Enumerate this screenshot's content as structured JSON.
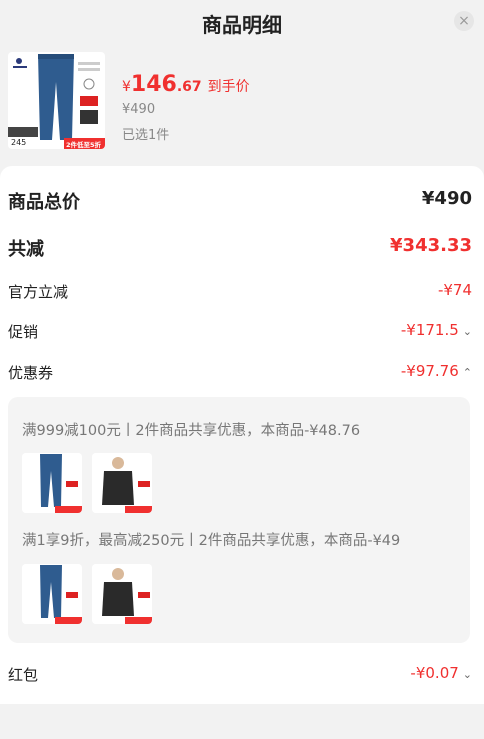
{
  "header": {
    "title": "商品明细",
    "close_glyph": "×"
  },
  "product": {
    "currency": "¥",
    "price_int": "146",
    "price_dec": ".67",
    "price_tag": "到手价",
    "original_price": "¥490",
    "selected": "已选1件",
    "thumb_badge_price": "245",
    "thumb_badge_text": "2件低至5折"
  },
  "summary": {
    "total_label": "商品总价",
    "total_value": "¥490",
    "reduce_label": "共减",
    "reduce_value": "¥343.33"
  },
  "discounts": [
    {
      "label": "官方立减",
      "value": "-¥74"
    },
    {
      "label": "促销",
      "value": "-¥171.5"
    },
    {
      "label": "优惠券",
      "value": "-¥97.76"
    }
  ],
  "coupons": [
    {
      "text": "满999减100元丨2件商品共享优惠，本商品-¥48.76"
    },
    {
      "text": "满1享9折，最高减250元丨2件商品共享优惠，本商品-¥49"
    }
  ],
  "redpacket": {
    "label": "红包",
    "value": "-¥0.07"
  },
  "colors": {
    "accent": "#f0302f",
    "jeans": "#2f5c8f",
    "tee": "#2a2a2a"
  },
  "icons": [
    "close-icon",
    "chevron-down-icon",
    "chevron-up-icon"
  ]
}
